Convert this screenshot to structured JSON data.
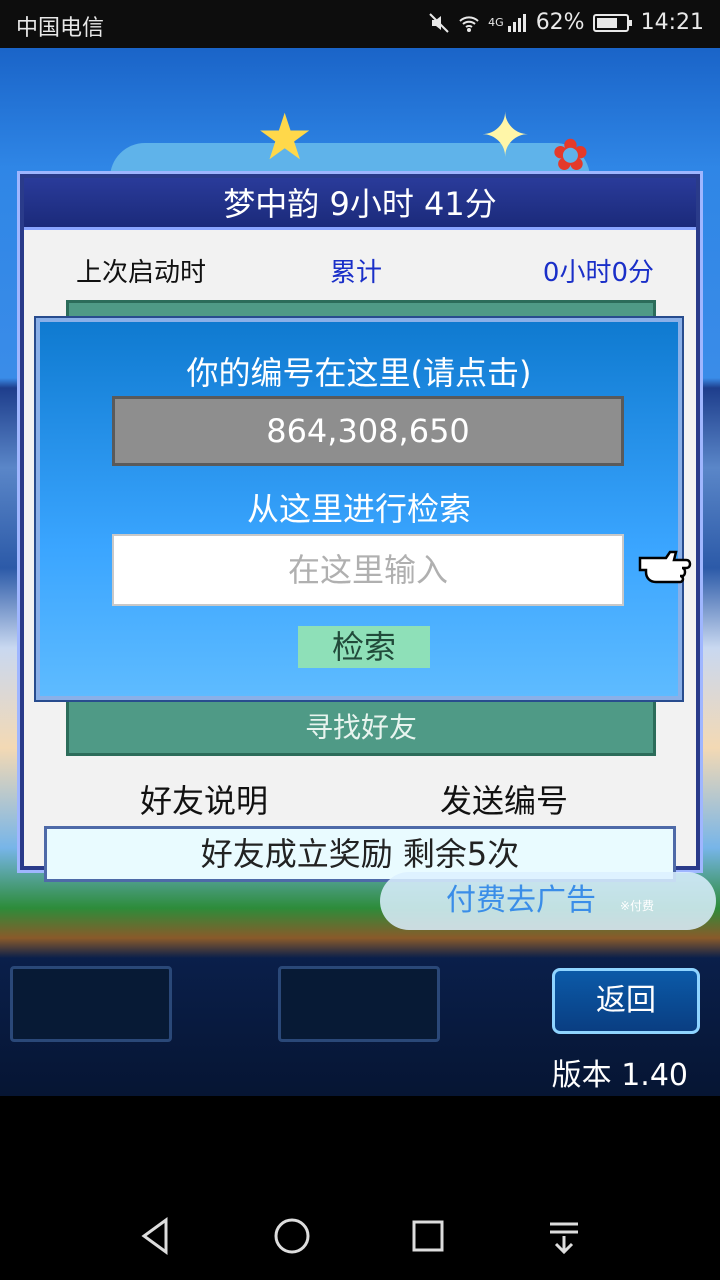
{
  "status_bar": {
    "carrier": "中国电信",
    "network": "4G",
    "battery": "62%",
    "time": "14:21"
  },
  "dialog": {
    "title": "梦中韵  9小时 41分",
    "stats": {
      "last_launch_label": "上次启动时",
      "total_label": "累计",
      "total_value": "0小时0分"
    },
    "find_friend_label": "寻找好友",
    "friend_info_label": "好友说明",
    "send_id_label": "发送编号"
  },
  "modal": {
    "id_prompt": "你的编号在这里(请点击)",
    "player_id": "864,308,650",
    "search_prompt": "从这里进行检索",
    "search_placeholder": "在这里输入",
    "search_button": "检索"
  },
  "reward_bar": "好友成立奖励  剩余5次",
  "ad": {
    "label": "付费去广告",
    "note": "※付费"
  },
  "back_button": "返回",
  "version": "版本 1.40",
  "colors": {
    "dialog_title_bg": "#1b2a7a",
    "modal_bg": "#3aa5ff",
    "green_panel": "#4f9a86",
    "search_button_bg": "#8ee0b8",
    "accent_blue_text": "#1a2fc8"
  }
}
